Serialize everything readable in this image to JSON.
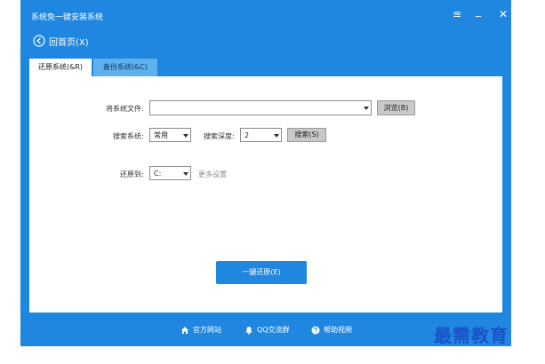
{
  "window": {
    "title": "系统免一键安装系统",
    "menu_glyph": "≡",
    "min_glyph": "_",
    "close_glyph": "✕"
  },
  "nav": {
    "home_label": "回首页(X)"
  },
  "tabs": [
    {
      "label": "还原系统(&R)",
      "active": true
    },
    {
      "label": "备份系统(&C)",
      "active": false
    }
  ],
  "form": {
    "system_file_label": "将系统文件:",
    "system_file_value": "",
    "browse_label": "浏览(B)",
    "search_system_label": "搜索系统:",
    "search_system_value": "常用",
    "search_depth_label": "搜索深度:",
    "search_depth_value": "2",
    "search_button_label": "搜索(S)",
    "restore_to_label": "还原到:",
    "restore_to_value": "C:",
    "more_settings_label": "更多设置"
  },
  "actions": {
    "restore_label": "一键还原(E)"
  },
  "footer": {
    "links": [
      {
        "label": "官方网站",
        "icon": "home-icon"
      },
      {
        "label": "QQ交流群",
        "icon": "bell-icon"
      },
      {
        "label": "帮助视频",
        "icon": "help-icon"
      }
    ]
  },
  "watermark": {
    "text": "最需教育"
  },
  "colors": {
    "accent": "#1f87df",
    "tab_inactive": "#5fb0ec",
    "watermark": "#1a52c8"
  }
}
